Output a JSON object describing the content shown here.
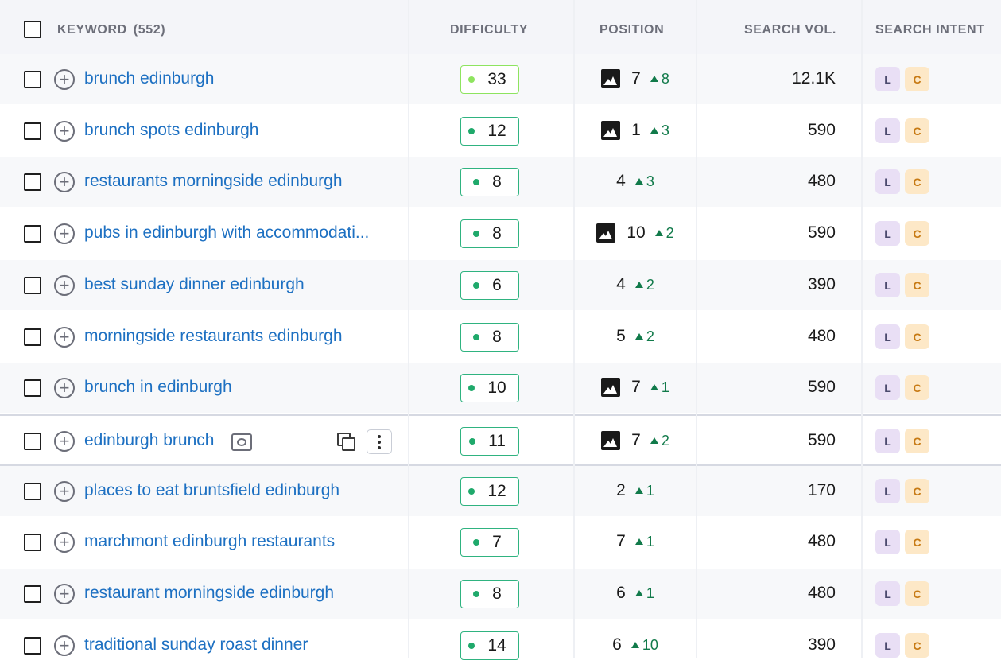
{
  "header": {
    "keyword_label": "KEYWORD",
    "keyword_count": "(552)",
    "difficulty": "DIFFICULTY",
    "position": "POSITION",
    "search_volume": "SEARCH VOL.",
    "search_intent": "SEARCH INTENT"
  },
  "rows": [
    {
      "keyword": "brunch edinburgh",
      "difficulty": "33",
      "position": "7",
      "change": "8",
      "volume": "12.1K",
      "image": true,
      "diff_color": "lime"
    },
    {
      "keyword": "brunch spots edinburgh",
      "difficulty": "12",
      "position": "1",
      "change": "3",
      "volume": "590",
      "image": true
    },
    {
      "keyword": "restaurants morningside edinburgh",
      "difficulty": "8",
      "position": "4",
      "change": "3",
      "volume": "480",
      "image": false
    },
    {
      "keyword": "pubs in edinburgh with accommodati...",
      "difficulty": "8",
      "position": "10",
      "change": "2",
      "volume": "590",
      "image": true
    },
    {
      "keyword": "best sunday dinner edinburgh",
      "difficulty": "6",
      "position": "4",
      "change": "2",
      "volume": "390",
      "image": false
    },
    {
      "keyword": "morningside restaurants edinburgh",
      "difficulty": "8",
      "position": "5",
      "change": "2",
      "volume": "480",
      "image": false
    },
    {
      "keyword": "brunch in edinburgh",
      "difficulty": "10",
      "position": "7",
      "change": "1",
      "volume": "590",
      "image": true
    },
    {
      "keyword": "edinburgh brunch",
      "difficulty": "11",
      "position": "7",
      "change": "2",
      "volume": "590",
      "image": true,
      "highlighted": true
    },
    {
      "keyword": "places to eat bruntsfield edinburgh",
      "difficulty": "12",
      "position": "2",
      "change": "1",
      "volume": "170",
      "image": false
    },
    {
      "keyword": "marchmont edinburgh restaurants",
      "difficulty": "7",
      "position": "7",
      "change": "1",
      "volume": "480",
      "image": false
    },
    {
      "keyword": "restaurant morningside edinburgh",
      "difficulty": "8",
      "position": "6",
      "change": "1",
      "volume": "480",
      "image": false
    },
    {
      "keyword": "traditional sunday roast dinner",
      "difficulty": "14",
      "position": "6",
      "change": "10",
      "volume": "390",
      "image": false
    }
  ],
  "intent_badges": {
    "local": "L",
    "commercial": "C"
  },
  "icons": {
    "add": "plus-circle-icon",
    "image_serp": "image-icon",
    "eye": "eye-icon",
    "copy": "copy-icon",
    "more": "more-vertical-icon"
  },
  "colors": {
    "link": "#1d70c2",
    "difficulty_border": "#2fb380",
    "difficulty_border_first": "#8ee45f",
    "change_up": "#117a4a",
    "badge_l_bg": "#e9dff5",
    "badge_c_bg": "#fde8c7"
  }
}
